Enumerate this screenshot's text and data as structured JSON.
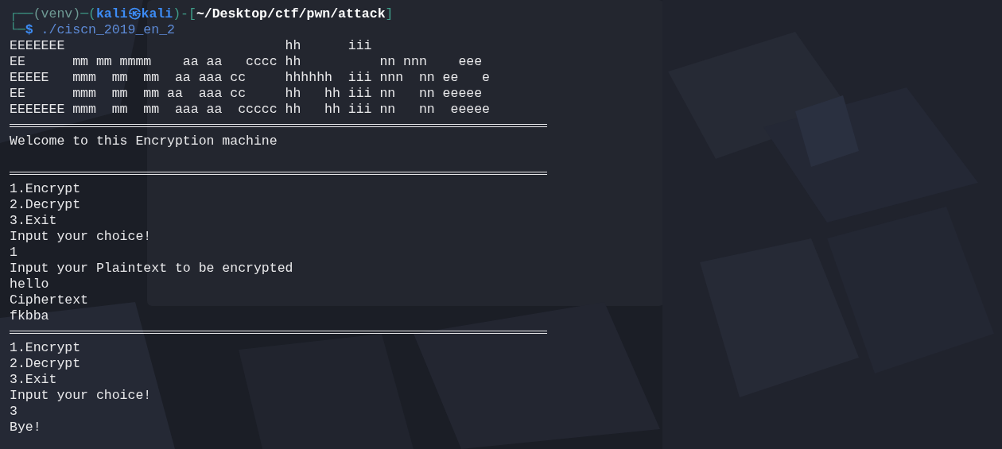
{
  "prompt": [
    {
      "kind": "frame",
      "text": "┌──"
    },
    {
      "kind": "venv",
      "text": "(venv)"
    },
    {
      "kind": "frame",
      "text": "─("
    },
    {
      "kind": "user",
      "text": "kali㉿kali"
    },
    {
      "kind": "frame",
      "text": ")-["
    },
    {
      "kind": "path",
      "text": "~/Desktop/ctf/pwn/attack"
    },
    {
      "kind": "frame",
      "text": "]"
    }
  ],
  "command_line": [
    {
      "kind": "frame",
      "text": "└─"
    },
    {
      "kind": "symbol",
      "text": "$"
    },
    {
      "kind": "command",
      "text": " ./ciscn_2019_en_2"
    }
  ],
  "lines": [
    {
      "kind": "text",
      "text": "EEEEEEE                            hh      iii"
    },
    {
      "kind": "text",
      "text": "EE      mm mm mmmm    aa aa   cccc hh          nn nnn    eee"
    },
    {
      "kind": "text",
      "text": "EEEEE   mmm  mm  mm  aa aaa cc     hhhhhh  iii nnn  nn ee   e"
    },
    {
      "kind": "text",
      "text": "EE      mmm  mm  mm aa  aaa cc     hh   hh iii nn   nn eeeee"
    },
    {
      "kind": "text",
      "text": "EEEEEEE mmm  mm  mm  aaa aa  ccccc hh   hh iii nn   nn  eeeee"
    },
    {
      "kind": "rule"
    },
    {
      "kind": "text",
      "text": "Welcome to this Encryption machine"
    },
    {
      "kind": "blank"
    },
    {
      "kind": "rule"
    },
    {
      "kind": "text",
      "text": "1.Encrypt"
    },
    {
      "kind": "text",
      "text": "2.Decrypt"
    },
    {
      "kind": "text",
      "text": "3.Exit"
    },
    {
      "kind": "text",
      "text": "Input your choice!"
    },
    {
      "kind": "input",
      "text": "1"
    },
    {
      "kind": "text",
      "text": "Input your Plaintext to be encrypted"
    },
    {
      "kind": "input",
      "text": "hello"
    },
    {
      "kind": "text",
      "text": "Ciphertext"
    },
    {
      "kind": "text",
      "text": "fkbba"
    },
    {
      "kind": "rule"
    },
    {
      "kind": "text",
      "text": "1.Encrypt"
    },
    {
      "kind": "text",
      "text": "2.Decrypt"
    },
    {
      "kind": "text",
      "text": "3.Exit"
    },
    {
      "kind": "text",
      "text": "Input your choice!"
    },
    {
      "kind": "input",
      "text": "3"
    },
    {
      "kind": "text",
      "text": "Bye!"
    }
  ]
}
